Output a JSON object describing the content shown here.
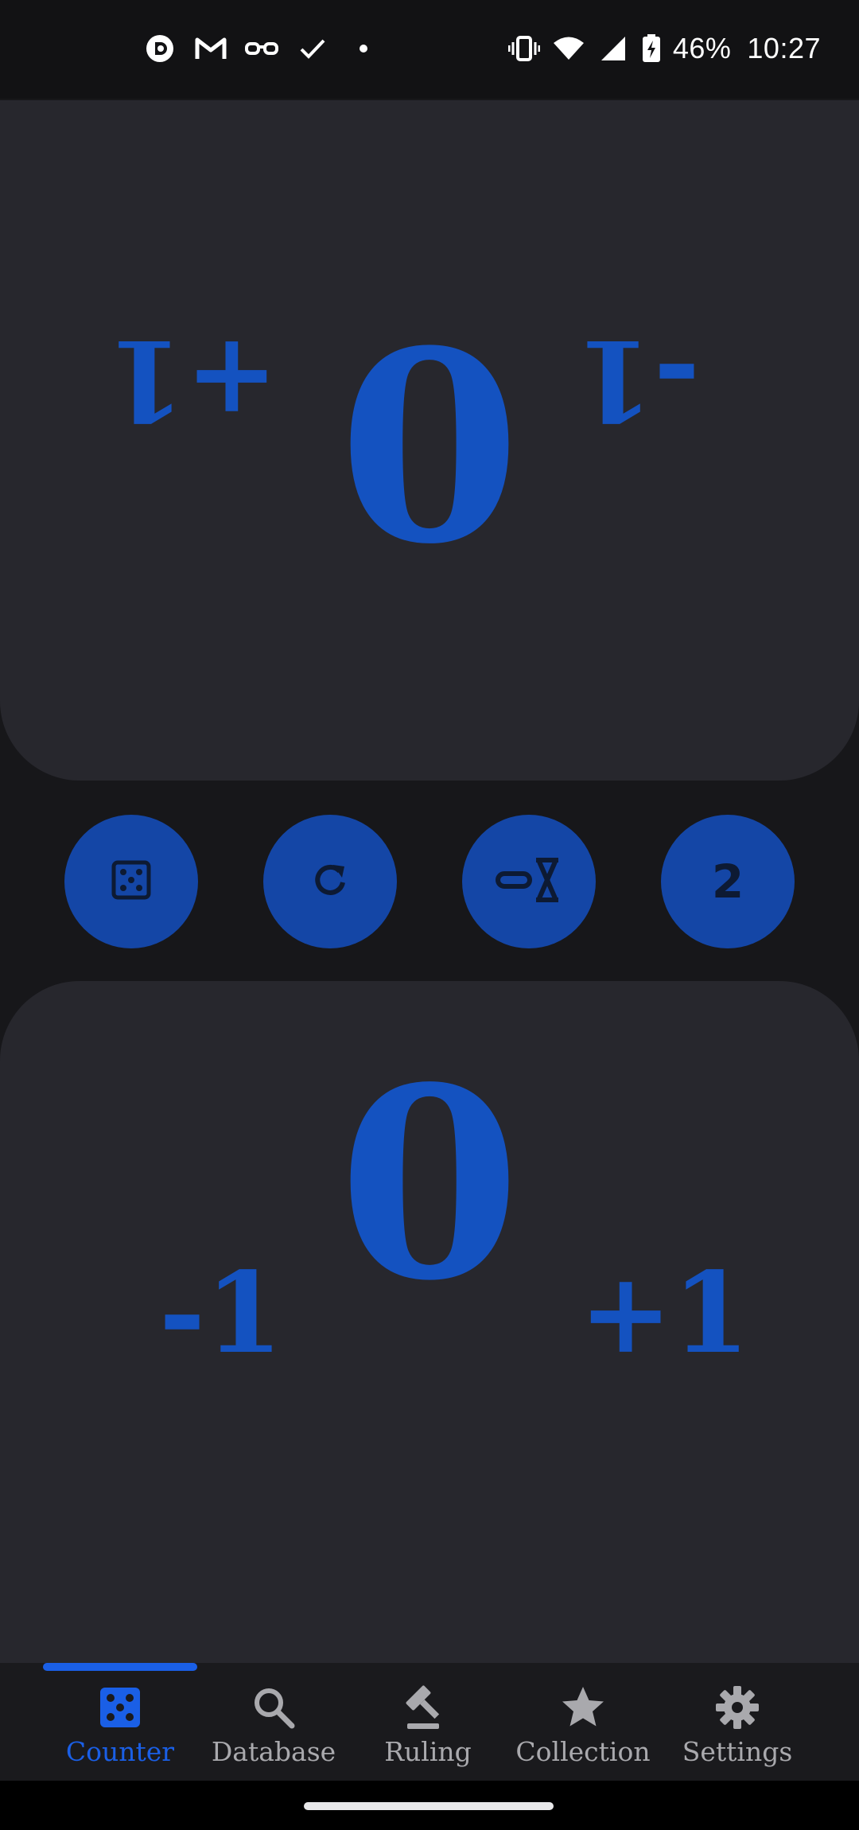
{
  "status_bar": {
    "time": "10:27",
    "battery": "46%",
    "left_icons": [
      "pocket-casts-icon",
      "gmail-icon",
      "glasses-icon",
      "check-icon",
      "dot-icon"
    ],
    "right_icons": [
      "vibrate-icon",
      "wifi-icon",
      "signal-icon",
      "battery-charging-icon"
    ]
  },
  "players": {
    "top": {
      "life": "0",
      "minus_label": "-1",
      "plus_label": "+1",
      "orientation": "rotated-180"
    },
    "bottom": {
      "life": "0",
      "minus_label": "-1",
      "plus_label": "+1"
    }
  },
  "actions": [
    {
      "name": "dice",
      "icon": "dice-icon"
    },
    {
      "name": "reset",
      "icon": "reset-icon"
    },
    {
      "name": "timer",
      "icon": "infinity-hourglass-icon"
    },
    {
      "name": "player-count",
      "label": "2"
    }
  ],
  "nav": {
    "items": [
      {
        "label": "Counter",
        "icon": "dice-icon",
        "active": true
      },
      {
        "label": "Database",
        "icon": "search-icon",
        "active": false
      },
      {
        "label": "Ruling",
        "icon": "gavel-icon",
        "active": false
      },
      {
        "label": "Collection",
        "icon": "star-icon",
        "active": false
      },
      {
        "label": "Settings",
        "icon": "gear-icon",
        "active": false
      }
    ]
  },
  "colors": {
    "accent": "#1452c0",
    "nav_active": "#1a5fe6",
    "panel_bg": "#27272d",
    "app_bg": "#17171a",
    "button_bg": "#1446a6"
  }
}
